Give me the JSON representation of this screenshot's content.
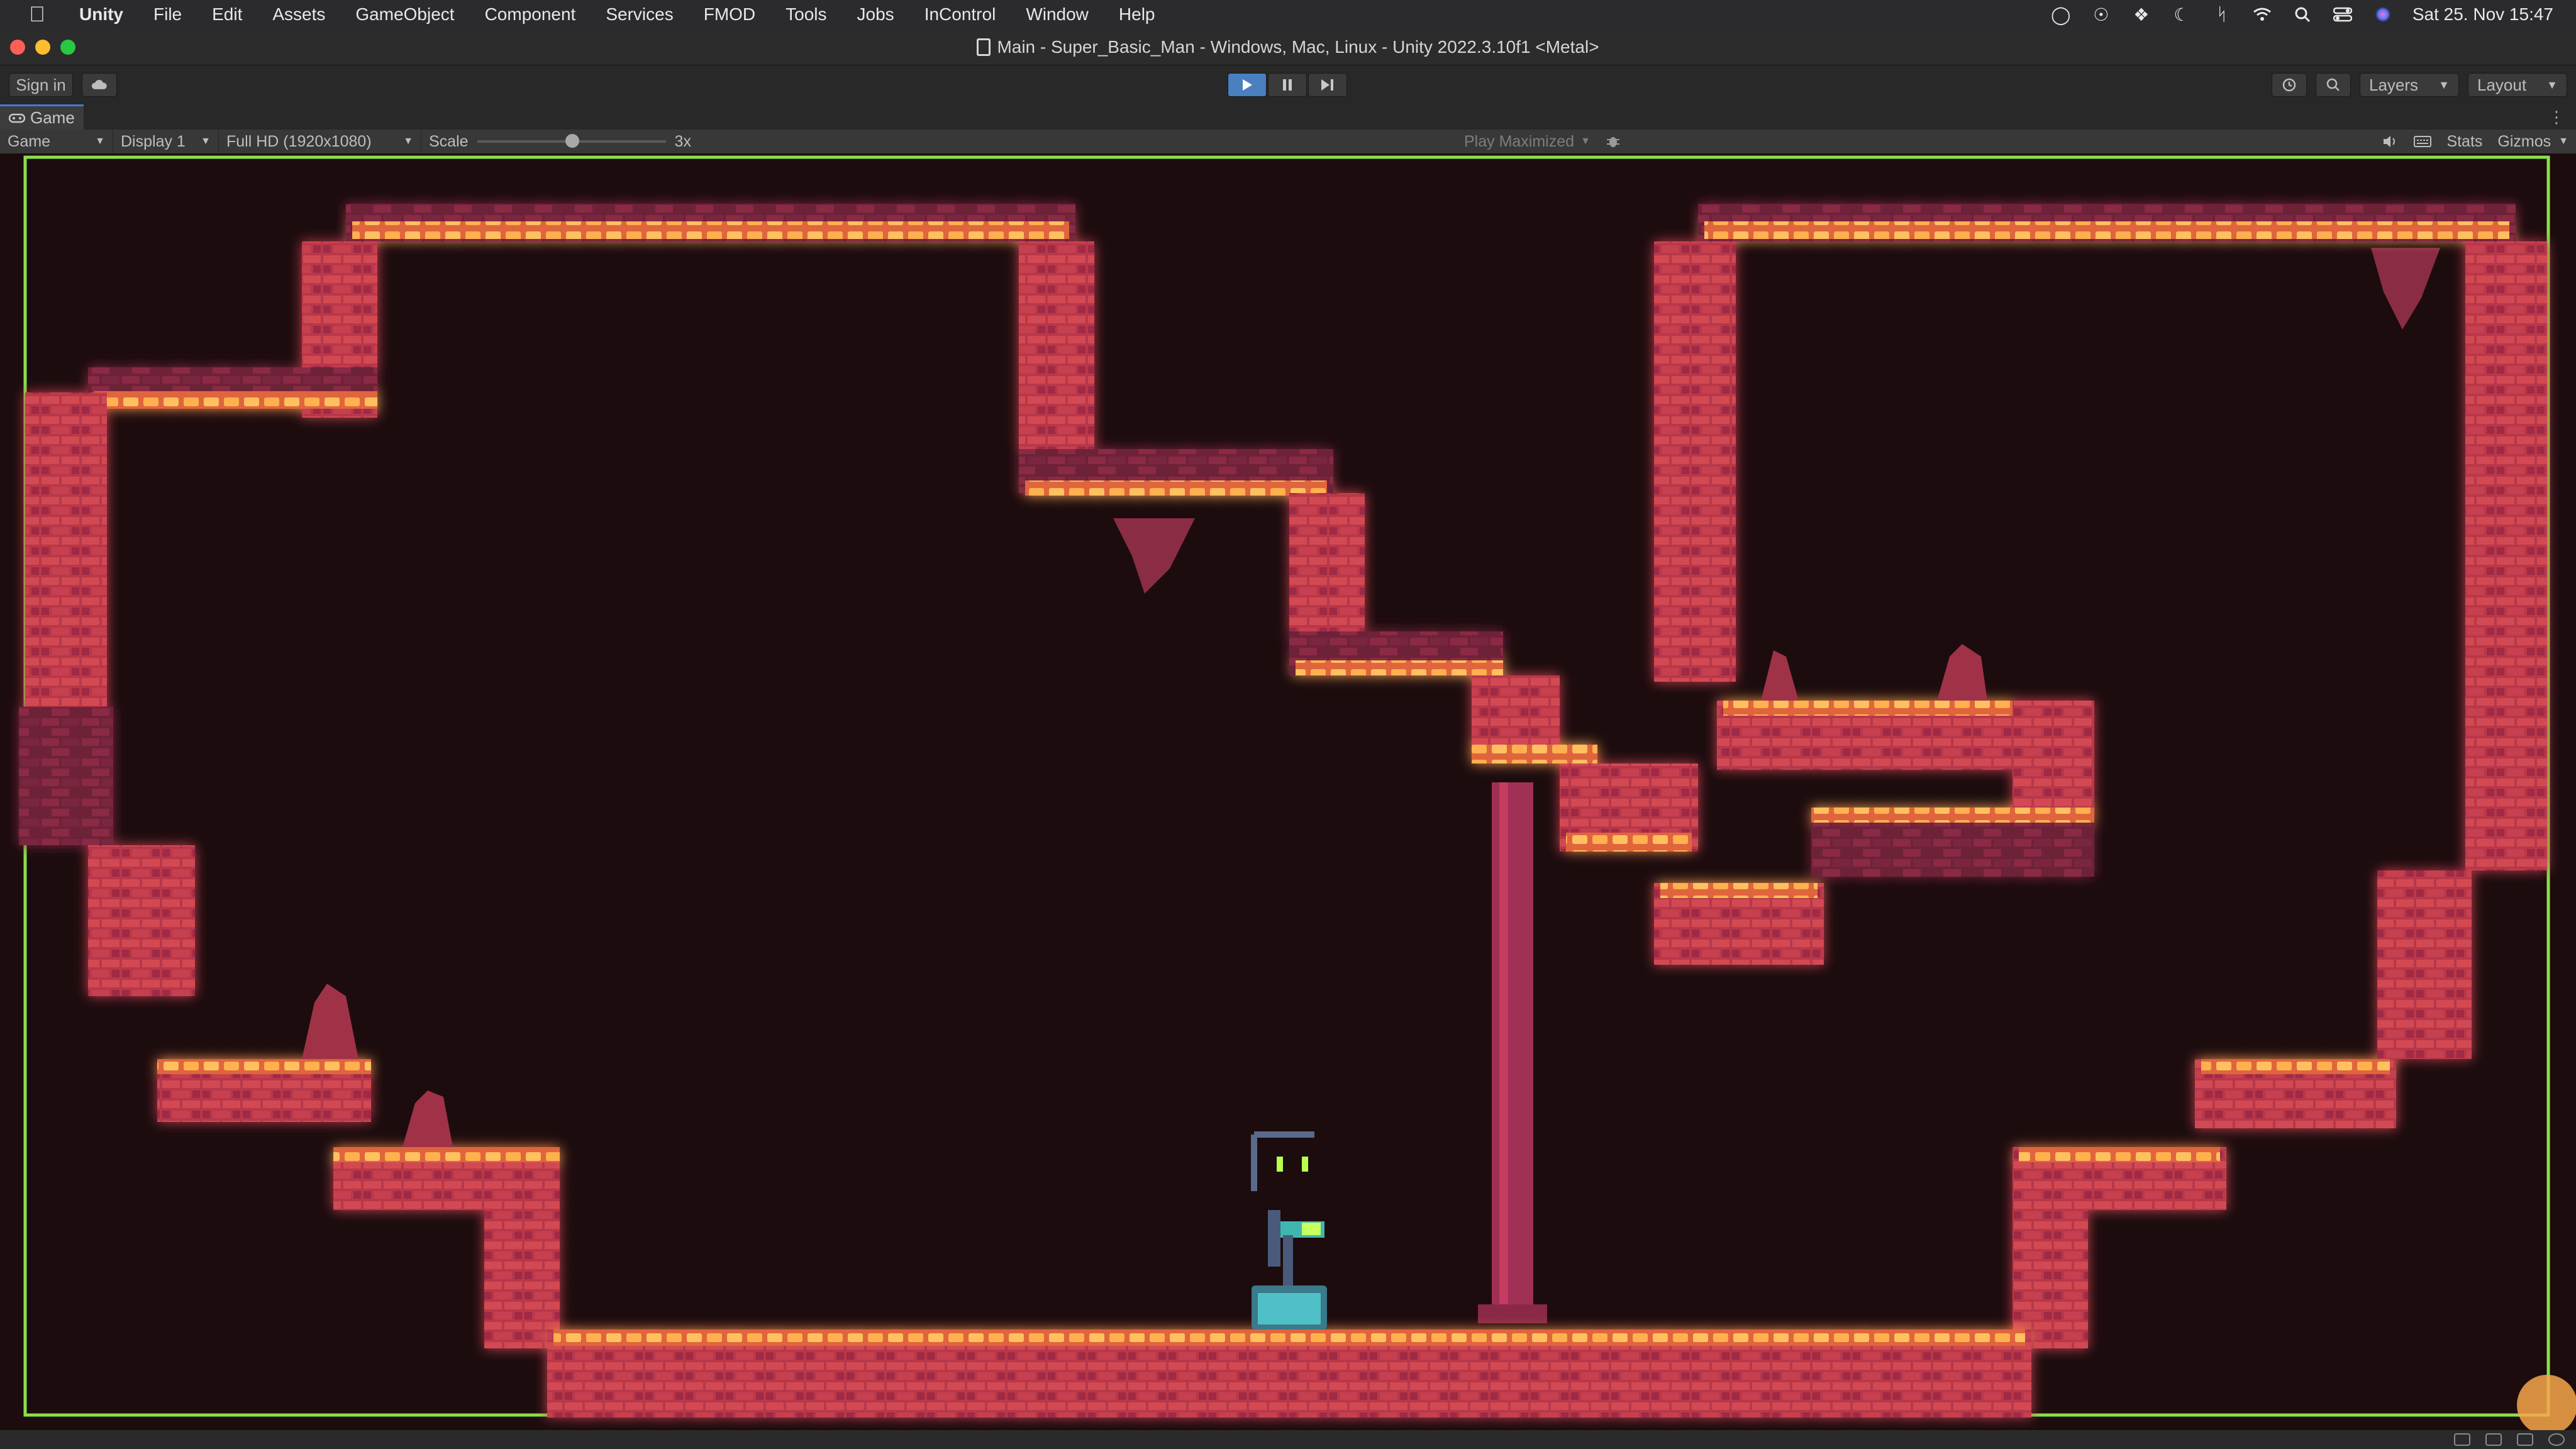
{
  "menubar": {
    "items": [
      "Unity",
      "File",
      "Edit",
      "Assets",
      "GameObject",
      "Component",
      "Services",
      "FMOD",
      "Tools",
      "Jobs",
      "InControl",
      "Window",
      "Help"
    ],
    "clock": "Sat 25. Nov  15:47"
  },
  "window": {
    "title": "Main - Super_Basic_Man - Windows, Mac, Linux - Unity 2022.3.10f1 <Metal>"
  },
  "toolbar": {
    "sign_in": "Sign in",
    "layers": "Layers",
    "layout": "Layout"
  },
  "tab": {
    "label": "Game"
  },
  "gamebar": {
    "view": "Game",
    "display": "Display 1",
    "resolution": "Full HD (1920x1080)",
    "scale_label": "Scale",
    "scale_value": "3x",
    "play_mode": "Play Maximized",
    "stats": "Stats",
    "gizmos": "Gizmos"
  },
  "colors": {
    "accent_play": "#4a7fc0",
    "tile_glow": "#f7a64a",
    "tile_body": "#b8384a",
    "tile_dark": "#6e2138",
    "background": "#1c0c0e",
    "camera_bounds": "#8ce04a",
    "player_teal": "#3fb7b0"
  }
}
